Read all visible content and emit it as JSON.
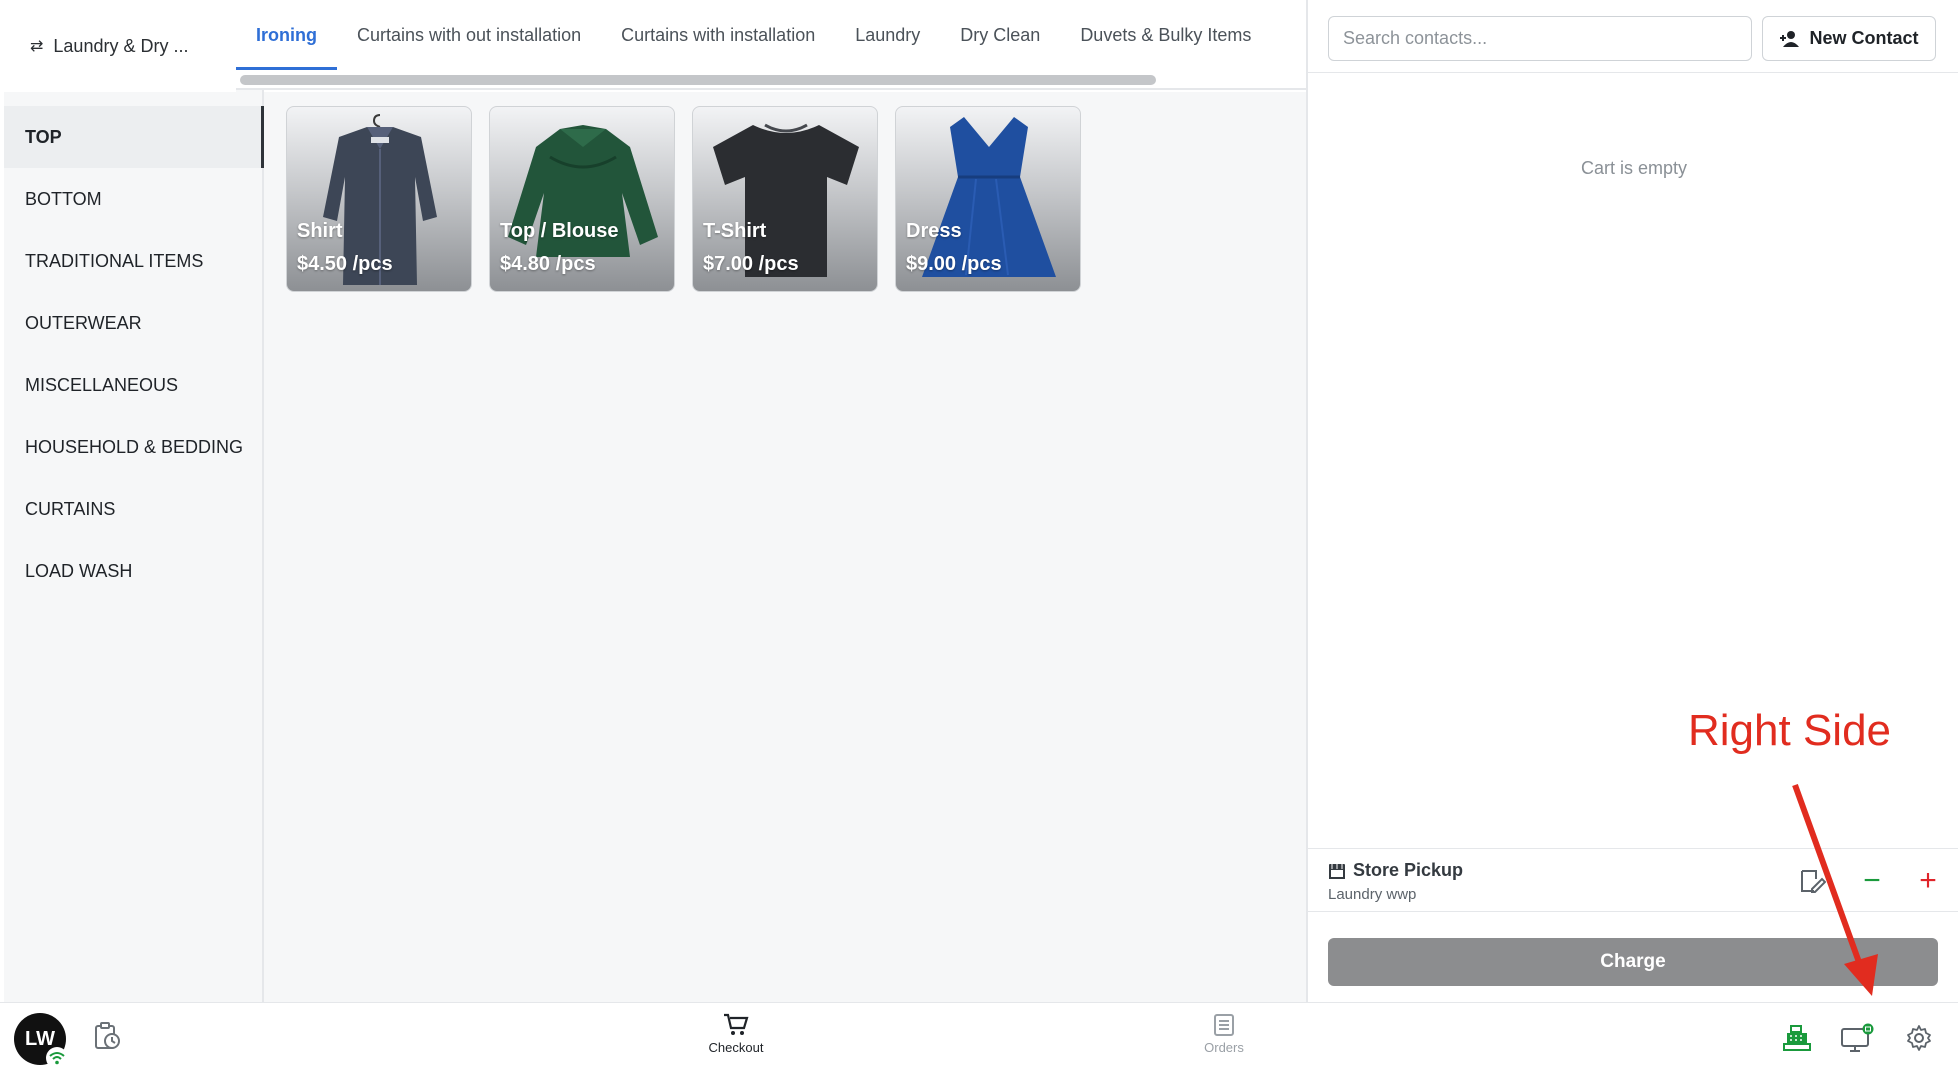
{
  "header": {
    "location_name": "Laundry & Dry ..."
  },
  "tabs": [
    {
      "label": "Ironing",
      "active": true
    },
    {
      "label": "Curtains with out installation"
    },
    {
      "label": "Curtains with installation"
    },
    {
      "label": "Laundry"
    },
    {
      "label": "Dry Clean"
    },
    {
      "label": "Duvets & Bulky Items"
    }
  ],
  "categories": [
    {
      "label": "TOP",
      "active": true
    },
    {
      "label": "BOTTOM"
    },
    {
      "label": "TRADITIONAL ITEMS"
    },
    {
      "label": "OUTERWEAR"
    },
    {
      "label": "MISCELLANEOUS"
    },
    {
      "label": "HOUSEHOLD & BEDDING"
    },
    {
      "label": "CURTAINS"
    },
    {
      "label": "LOAD WASH"
    }
  ],
  "products": [
    {
      "name": "Shirt",
      "price": "$4.50 /pcs",
      "icon": "shirt-image",
      "color": "#3d4656"
    },
    {
      "name": "Top / Blouse",
      "price": "$4.80 /pcs",
      "icon": "blouse-image",
      "color": "#22553a"
    },
    {
      "name": "T-Shirt",
      "price": "$7.00 /pcs",
      "icon": "tshirt-image",
      "color": "#2b2d31"
    },
    {
      "name": "Dress",
      "price": "$9.00 /pcs",
      "icon": "dress-image",
      "color": "#1f4fa0"
    }
  ],
  "contacts": {
    "search_placeholder": "Search contacts...",
    "new_contact_label": "New Contact"
  },
  "cart": {
    "empty_text": "Cart is empty",
    "fulfillment_title": "Store Pickup",
    "fulfillment_subtitle": "Laundry wwp",
    "charge_label": "Charge"
  },
  "bottom_nav": {
    "user_initials": "LW",
    "checkout_label": "Checkout",
    "orders_label": "Orders"
  },
  "annotation": {
    "label": "Right Side"
  },
  "colors": {
    "accent": "#2f6fd6",
    "positive": "#1a9a3c",
    "negative": "#e0242a",
    "annotation": "#e12c1f",
    "charge_disabled": "#8c8d8f"
  }
}
